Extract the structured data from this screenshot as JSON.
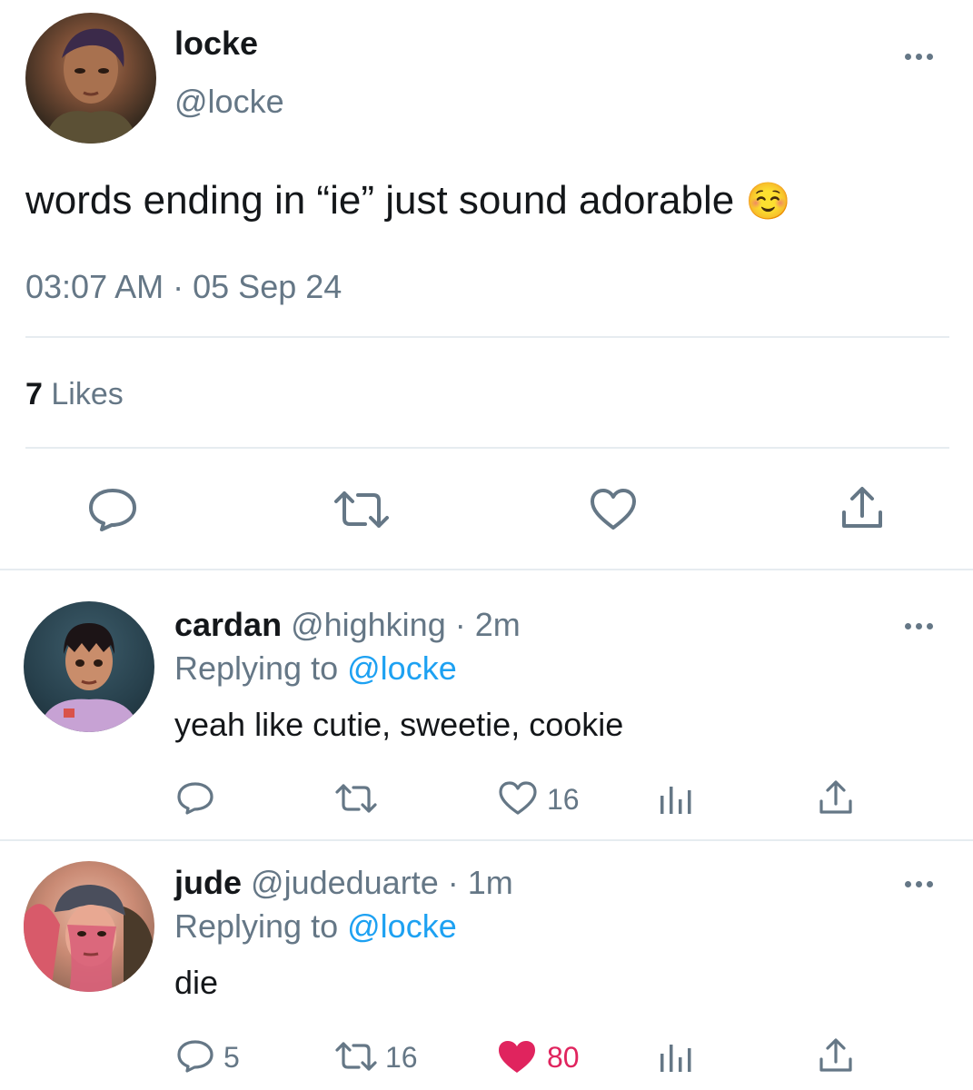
{
  "tweet": {
    "author_name": "locke",
    "author_handle": "@locke",
    "text": "words ending in “ie” just sound adorable",
    "emoji": "☺️",
    "time": "03:07 AM",
    "separator": "·",
    "date": "05 Sep 24",
    "likes_count": "7",
    "likes_label": "Likes"
  },
  "replies": [
    {
      "name": "cardan",
      "handle": "@highking",
      "age": "· 2m",
      "replying_prefix": "Replying to",
      "replying_to": "@locke",
      "text": "yeah like cutie, sweetie, cookie",
      "reply_count": "",
      "retweet_count": "",
      "like_count": "16",
      "liked": false
    },
    {
      "name": "jude",
      "handle": "@judeduarte",
      "age": "· 1m",
      "replying_prefix": "Replying to",
      "replying_to": "@locke",
      "text": "die",
      "reply_count": "5",
      "retweet_count": "16",
      "like_count": "80",
      "liked": true
    }
  ],
  "colors": {
    "text": "#14171a",
    "secondary": "#657786",
    "link": "#1da1f2",
    "like": "#e0245e",
    "divider": "#e6ecf0"
  },
  "icons": [
    "more-icon",
    "reply-icon",
    "retweet-icon",
    "like-icon",
    "share-icon",
    "analytics-icon"
  ]
}
